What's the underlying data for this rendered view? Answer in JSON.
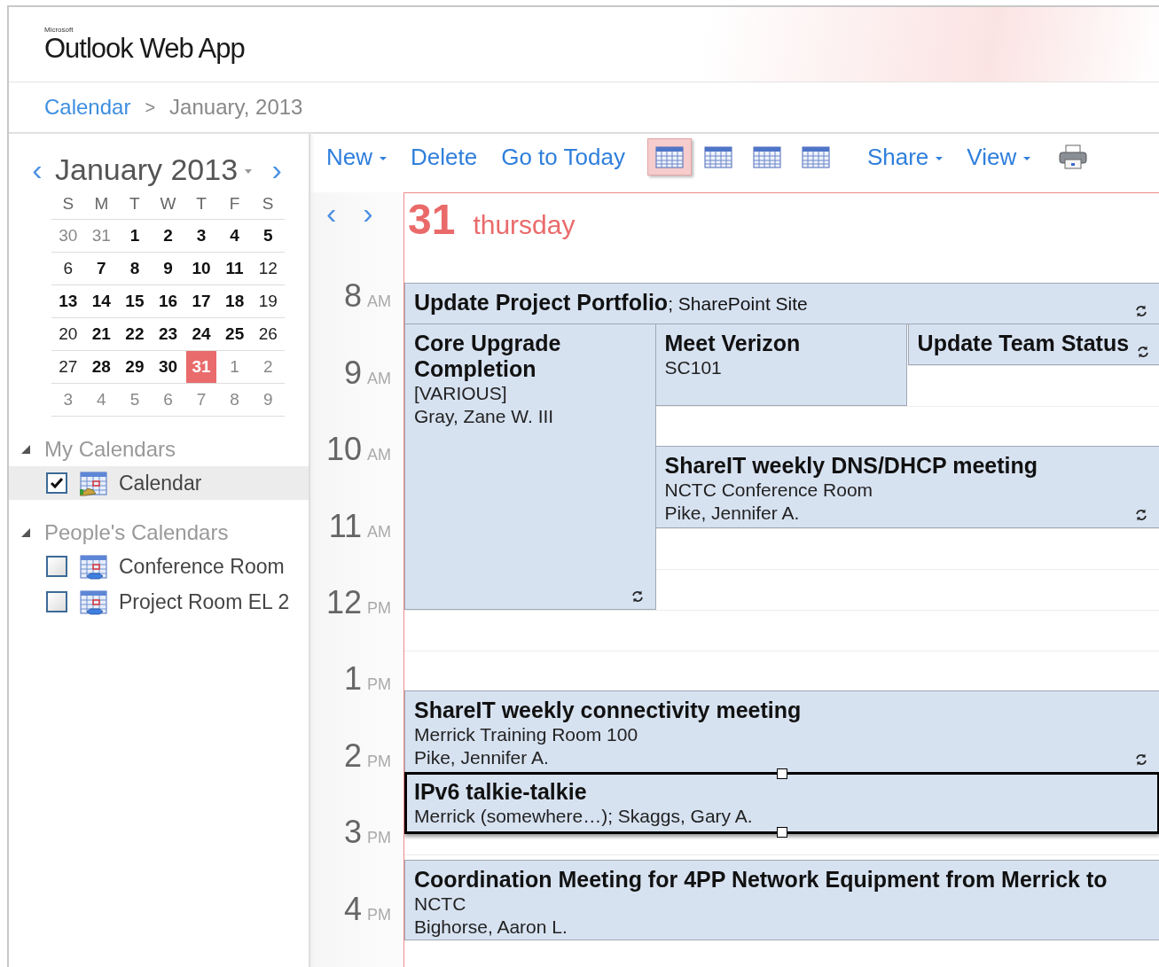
{
  "header": {
    "brand_small": "Microsoft",
    "brand": "Outlook Web App"
  },
  "breadcrumb": {
    "link": "Calendar",
    "separator": ">",
    "current": "January, 2013"
  },
  "mini_calendar": {
    "title": "January 2013",
    "prev": "‹",
    "next": "›",
    "weekdays": [
      "S",
      "M",
      "T",
      "W",
      "T",
      "F",
      "S"
    ],
    "weeks": [
      [
        {
          "day": "30",
          "muted": true,
          "busy": false,
          "selected": false
        },
        {
          "day": "31",
          "muted": true,
          "busy": false,
          "selected": false
        },
        {
          "day": "1",
          "muted": false,
          "busy": true,
          "selected": false
        },
        {
          "day": "2",
          "muted": false,
          "busy": true,
          "selected": false
        },
        {
          "day": "3",
          "muted": false,
          "busy": true,
          "selected": false
        },
        {
          "day": "4",
          "muted": false,
          "busy": true,
          "selected": false
        },
        {
          "day": "5",
          "muted": false,
          "busy": true,
          "selected": false
        }
      ],
      [
        {
          "day": "6",
          "muted": false,
          "busy": false,
          "selected": false
        },
        {
          "day": "7",
          "muted": false,
          "busy": true,
          "selected": false
        },
        {
          "day": "8",
          "muted": false,
          "busy": true,
          "selected": false
        },
        {
          "day": "9",
          "muted": false,
          "busy": true,
          "selected": false
        },
        {
          "day": "10",
          "muted": false,
          "busy": true,
          "selected": false
        },
        {
          "day": "11",
          "muted": false,
          "busy": true,
          "selected": false
        },
        {
          "day": "12",
          "muted": false,
          "busy": false,
          "selected": false
        }
      ],
      [
        {
          "day": "13",
          "muted": false,
          "busy": true,
          "selected": false
        },
        {
          "day": "14",
          "muted": false,
          "busy": true,
          "selected": false
        },
        {
          "day": "15",
          "muted": false,
          "busy": true,
          "selected": false
        },
        {
          "day": "16",
          "muted": false,
          "busy": true,
          "selected": false
        },
        {
          "day": "17",
          "muted": false,
          "busy": true,
          "selected": false
        },
        {
          "day": "18",
          "muted": false,
          "busy": true,
          "selected": false
        },
        {
          "day": "19",
          "muted": false,
          "busy": false,
          "selected": false
        }
      ],
      [
        {
          "day": "20",
          "muted": false,
          "busy": false,
          "selected": false
        },
        {
          "day": "21",
          "muted": false,
          "busy": true,
          "selected": false
        },
        {
          "day": "22",
          "muted": false,
          "busy": true,
          "selected": false
        },
        {
          "day": "23",
          "muted": false,
          "busy": true,
          "selected": false
        },
        {
          "day": "24",
          "muted": false,
          "busy": true,
          "selected": false
        },
        {
          "day": "25",
          "muted": false,
          "busy": true,
          "selected": false
        },
        {
          "day": "26",
          "muted": false,
          "busy": false,
          "selected": false
        }
      ],
      [
        {
          "day": "27",
          "muted": false,
          "busy": false,
          "selected": false
        },
        {
          "day": "28",
          "muted": false,
          "busy": true,
          "selected": false
        },
        {
          "day": "29",
          "muted": false,
          "busy": true,
          "selected": false
        },
        {
          "day": "30",
          "muted": false,
          "busy": true,
          "selected": false
        },
        {
          "day": "31",
          "muted": false,
          "busy": true,
          "selected": true
        },
        {
          "day": "1",
          "muted": true,
          "busy": false,
          "selected": false
        },
        {
          "day": "2",
          "muted": true,
          "busy": false,
          "selected": false
        }
      ],
      [
        {
          "day": "3",
          "muted": true,
          "busy": false,
          "selected": false
        },
        {
          "day": "4",
          "muted": true,
          "busy": false,
          "selected": false
        },
        {
          "day": "5",
          "muted": true,
          "busy": false,
          "selected": false
        },
        {
          "day": "6",
          "muted": true,
          "busy": false,
          "selected": false
        },
        {
          "day": "7",
          "muted": true,
          "busy": false,
          "selected": false
        },
        {
          "day": "8",
          "muted": true,
          "busy": false,
          "selected": false
        },
        {
          "day": "9",
          "muted": true,
          "busy": false,
          "selected": false
        }
      ]
    ]
  },
  "calendar_groups": [
    {
      "title": "My Calendars",
      "expanded": true,
      "items": [
        {
          "name": "Calendar",
          "checked": true,
          "selected": true,
          "kind": "own"
        }
      ]
    },
    {
      "title": "People's Calendars",
      "expanded": true,
      "items": [
        {
          "name": "Conference Room",
          "checked": false,
          "selected": false,
          "kind": "room"
        },
        {
          "name": "Project Room EL 2",
          "checked": false,
          "selected": false,
          "kind": "room"
        }
      ]
    }
  ],
  "toolbar": {
    "actions": [
      {
        "label": "New",
        "dropdown": true
      },
      {
        "label": "Delete",
        "dropdown": false
      },
      {
        "label": "Go to Today",
        "dropdown": false
      }
    ],
    "views": [
      {
        "selected": true
      },
      {
        "selected": false
      },
      {
        "selected": false
      },
      {
        "selected": false
      }
    ],
    "menus": [
      {
        "label": "Share",
        "dropdown": true
      },
      {
        "label": "View",
        "dropdown": true
      }
    ]
  },
  "day_view": {
    "prev": "‹",
    "next": "›",
    "date": "31",
    "weekday": "thursday",
    "hours": [
      {
        "hour": "8",
        "period": "AM"
      },
      {
        "hour": "9",
        "period": "AM"
      },
      {
        "hour": "10",
        "period": "AM"
      },
      {
        "hour": "11",
        "period": "AM"
      },
      {
        "hour": "12",
        "period": "PM"
      },
      {
        "hour": "1",
        "period": "PM"
      },
      {
        "hour": "2",
        "period": "PM"
      },
      {
        "hour": "3",
        "period": "PM"
      },
      {
        "hour": "4",
        "period": "PM"
      }
    ],
    "events": [
      {
        "subject": "Update Project Portfolio",
        "location_inline": "; SharePoint Site",
        "recurring": true,
        "selected": false
      },
      {
        "subject": "Core Upgrade Completion",
        "details": [
          "[VARIOUS]",
          "Gray, Zane W. III"
        ],
        "recurring": true,
        "selected": false
      },
      {
        "subject": "Meet Verizon",
        "details": [
          "SC101"
        ],
        "recurring": false,
        "selected": false
      },
      {
        "subject": "Update Team Status",
        "recurring": true,
        "selected": false
      },
      {
        "subject": "ShareIT weekly DNS/DHCP meeting",
        "details": [
          "NCTC Conference Room",
          "Pike, Jennifer A."
        ],
        "recurring": true,
        "selected": false
      },
      {
        "subject": "ShareIT weekly connectivity meeting",
        "details": [
          "Merrick Training Room 100",
          "Pike, Jennifer A."
        ],
        "recurring": true,
        "selected": false
      },
      {
        "subject": "IPv6 talkie-talkie",
        "details": [
          "Merrick (somewhere…); Skaggs, Gary A."
        ],
        "recurring": false,
        "selected": true
      },
      {
        "subject": "Coordination Meeting for 4PP Network Equipment from Merrick to",
        "details": [
          "NCTC",
          "Bighorse, Aaron L."
        ],
        "recurring": false,
        "selected": false
      }
    ]
  }
}
